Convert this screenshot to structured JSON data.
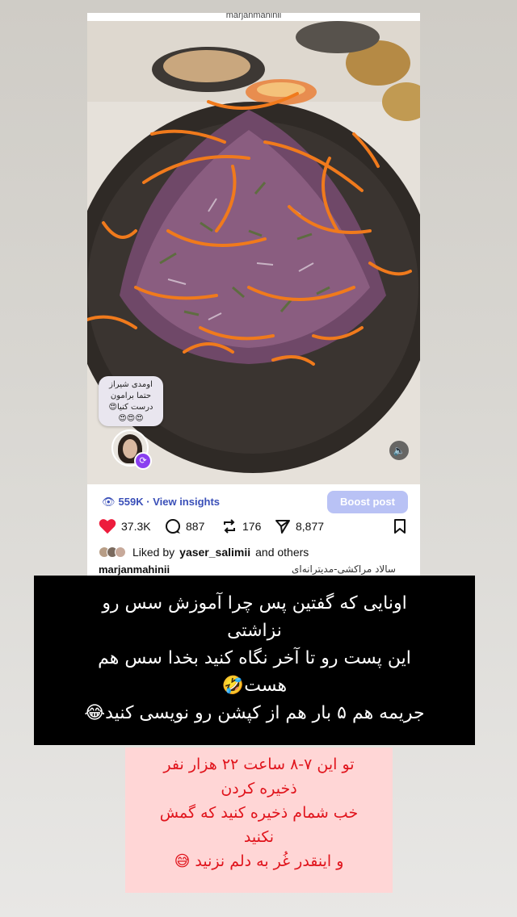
{
  "post": {
    "top_username": "marjanmahinii",
    "sticker_lines": [
      "اومدی شیراز",
      "حتما برامون",
      "درست کنیا😍",
      "😍😍😍"
    ],
    "insights": {
      "views": "559K",
      "separator": "·",
      "link": "View insights"
    },
    "boost_label": "Boost post",
    "stats": {
      "likes": "37.3K",
      "comments": "887",
      "reposts": "176",
      "shares": "8,877"
    },
    "liked_by": {
      "prefix": "Liked by",
      "user": "yaser_salimii",
      "suffix": "and others"
    },
    "caption": {
      "username": "marjanmahinii",
      "text": "سالاد مراکشی-مدیترانه‌ای"
    }
  },
  "overlay_black": {
    "lines": [
      "اونایی که گفتین پس چرا آموزش سس رو",
      "نزاشتی",
      "این پست رو تا آخر نگاه کنید بخدا سس هم",
      "هست🤣",
      "جریمه هم ۵ بار هم از کپشن رو نویسی کنید😂"
    ]
  },
  "overlay_pink": {
    "lines": [
      "تو این ۷-۸ ساعت ۲۲ هزار نفر",
      "ذخیره کردن",
      "خب شمام ذخیره کنید که گمش",
      "نکنید",
      "و اینقدر غُر به دلم نزنید 😅"
    ]
  },
  "icons": {
    "heart": "heart-icon",
    "comment": "comment-icon",
    "repost": "repost-icon",
    "share": "send-icon",
    "save": "bookmark-icon",
    "mute": "speaker-mute-icon",
    "eye": "eye-icon"
  },
  "colors": {
    "like": "#ed1c3c",
    "insights": "#3a4fb8",
    "boost_bg": "#b9c2f5",
    "pink_text": "#e0141c",
    "pink_bg": "#ffd6d6"
  }
}
